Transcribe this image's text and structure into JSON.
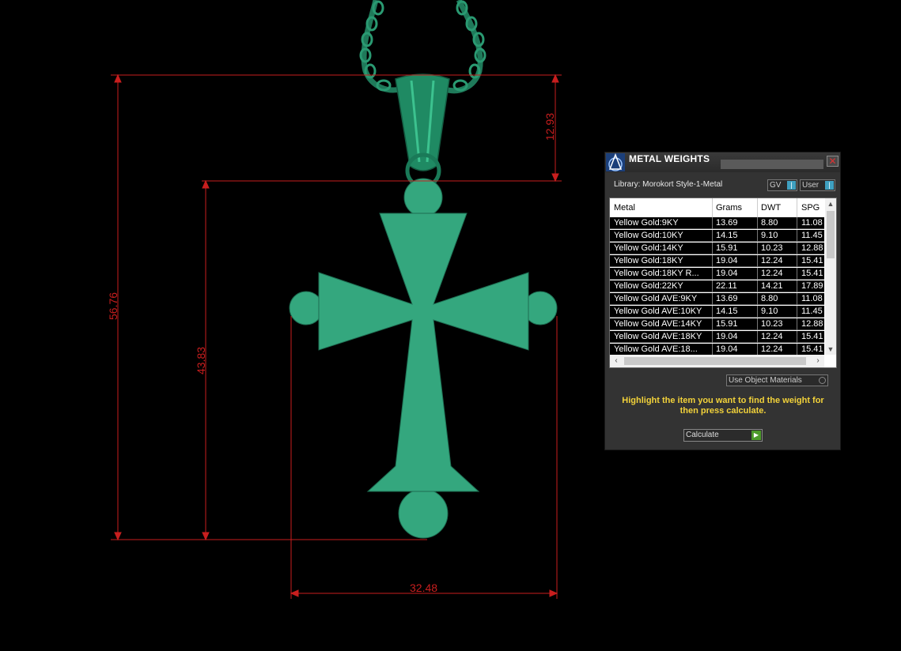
{
  "viewport": {
    "dimensions": {
      "total_height": "56.76",
      "inner_height": "43.83",
      "bail_height": "12.93",
      "width": "32.48"
    },
    "model_color": "#34a77e",
    "dimension_color": "#c81e1e"
  },
  "panel": {
    "title": "METAL WEIGHTS",
    "close_symbol": "✕",
    "library_label": "Library: Morokort Style-1-Metal",
    "toggle_gv_label": "GV",
    "toggle_user_label": "User",
    "columns": [
      "Metal",
      "Grams",
      "DWT",
      "SPG"
    ],
    "rows": [
      {
        "metal": "Yellow Gold:9KY",
        "grams": "13.69",
        "dwt": "8.80",
        "spg": "11.08"
      },
      {
        "metal": "Yellow Gold:10KY",
        "grams": "14.15",
        "dwt": "9.10",
        "spg": "11.45"
      },
      {
        "metal": "Yellow Gold:14KY",
        "grams": "15.91",
        "dwt": "10.23",
        "spg": "12.88"
      },
      {
        "metal": "Yellow Gold:18KY",
        "grams": "19.04",
        "dwt": "12.24",
        "spg": "15.41"
      },
      {
        "metal": "Yellow Gold:18KY R...",
        "grams": "19.04",
        "dwt": "12.24",
        "spg": "15.41"
      },
      {
        "metal": "Yellow Gold:22KY",
        "grams": "22.11",
        "dwt": "14.21",
        "spg": "17.89"
      },
      {
        "metal": "Yellow Gold AVE:9KY",
        "grams": "13.69",
        "dwt": "8.80",
        "spg": "11.08"
      },
      {
        "metal": "Yellow Gold AVE:10KY",
        "grams": "14.15",
        "dwt": "9.10",
        "spg": "11.45"
      },
      {
        "metal": "Yellow Gold AVE:14KY",
        "grams": "15.91",
        "dwt": "10.23",
        "spg": "12.88"
      },
      {
        "metal": "Yellow Gold AVE:18KY",
        "grams": "19.04",
        "dwt": "12.24",
        "spg": "15.41"
      },
      {
        "metal": "Yellow Gold AVE:18...",
        "grams": "19.04",
        "dwt": "12.24",
        "spg": "15.41"
      }
    ],
    "use_object_materials_label": "Use Object Materials",
    "instructions": "Highlight the item you want to find the weight for then press calculate.",
    "calculate_label": "Calculate",
    "accent_color": "#f2d23a"
  }
}
